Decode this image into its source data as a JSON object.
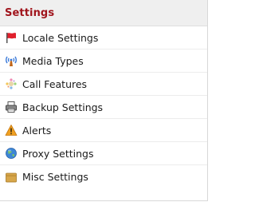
{
  "panel": {
    "title": "Settings",
    "title_color": "#a0141c",
    "items": [
      {
        "label": "Locale Settings",
        "icon": "red-flag-icon"
      },
      {
        "label": "Media Types",
        "icon": "antenna-broadcast-icon"
      },
      {
        "label": "Call Features",
        "icon": "sparkle-icon"
      },
      {
        "label": "Backup Settings",
        "icon": "printer-icon"
      },
      {
        "label": "Alerts",
        "icon": "warning-triangle-icon"
      },
      {
        "label": "Proxy Settings",
        "icon": "globe-icon"
      },
      {
        "label": "Misc Settings",
        "icon": "folder-icon"
      }
    ]
  }
}
